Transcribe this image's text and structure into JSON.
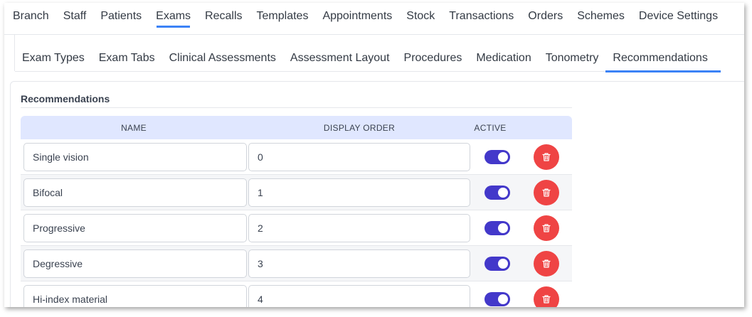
{
  "top_nav": {
    "tabs": [
      "Branch",
      "Staff",
      "Patients",
      "Exams",
      "Recalls",
      "Templates",
      "Appointments",
      "Stock",
      "Transactions",
      "Orders",
      "Schemes",
      "Device Settings"
    ],
    "active": "Exams"
  },
  "sub_nav": {
    "tabs": [
      "Exam Types",
      "Exam Tabs",
      "Clinical Assessments",
      "Assessment Layout",
      "Procedures",
      "Medication",
      "Tonometry",
      "Recommendations"
    ],
    "active": "Recommendations"
  },
  "section": {
    "title": "Recommendations"
  },
  "table": {
    "headers": {
      "name": "NAME",
      "display_order": "DISPLAY ORDER",
      "active": "ACTIVE"
    },
    "rows": [
      {
        "name": "Single vision",
        "display_order": "0",
        "active": true
      },
      {
        "name": "Bifocal",
        "display_order": "1",
        "active": true
      },
      {
        "name": "Progressive",
        "display_order": "2",
        "active": true
      },
      {
        "name": "Degressive",
        "display_order": "3",
        "active": true
      },
      {
        "name": "Hi-index material",
        "display_order": "4",
        "active": true
      }
    ]
  },
  "icons": {
    "delete": "trash-icon"
  },
  "colors": {
    "accent": "#3b82f6",
    "toggle_on": "#4338ca",
    "delete": "#ef4444",
    "header_bg": "#e0e7ff"
  }
}
